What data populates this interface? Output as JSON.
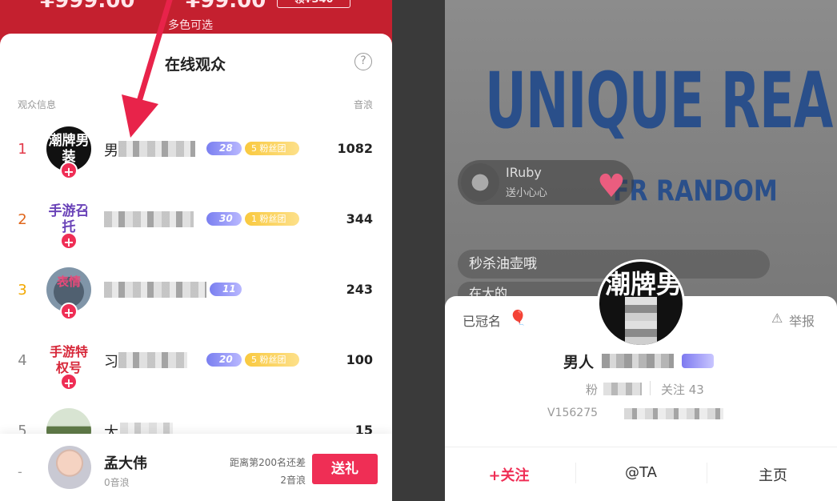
{
  "product": {
    "price_original": "¥999.00",
    "price_sale": "¥99.00",
    "coupon": "领¥340",
    "colors_note": "多色可选"
  },
  "audience": {
    "title": "在线观众",
    "col_left": "观众信息",
    "col_right": "音浪",
    "rows": [
      {
        "rank": "1",
        "avatar_text": "潮牌男装",
        "name": "男",
        "level": "28",
        "fan": "5 粉丝团",
        "score": "1082"
      },
      {
        "rank": "2",
        "avatar_text": "手游召托",
        "name": "",
        "level": "30",
        "fan": "1 粉丝团",
        "score": "344"
      },
      {
        "rank": "3",
        "avatar_text": "表情",
        "name": "",
        "level": "11",
        "fan": "",
        "score": "243"
      },
      {
        "rank": "4",
        "avatar_text": "手游特权号",
        "name": "习",
        "level": "20",
        "fan": "5 粉丝团",
        "score": "100"
      },
      {
        "rank": "5",
        "avatar_text": "",
        "name": "大",
        "level": "",
        "fan": "",
        "score": "15"
      }
    ]
  },
  "me": {
    "rank": "-",
    "name": "孟大伟",
    "sub": "0音浪",
    "gap_line1": "距离第200名还差",
    "gap_line2": "2音浪",
    "gift_label": "送礼"
  },
  "live": {
    "brand_line1": "UNIQUE REALITY",
    "brand_line2": "FR  RANDOM",
    "host_name": "IRuby",
    "host_sub": "送小心心",
    "chat1": "秒杀油壶哦",
    "chat2": "在大的"
  },
  "profile_card": {
    "crowned": "已冠名",
    "report": "举报",
    "avatar_text": "潮牌男",
    "name": "男人",
    "fans_label": "粉",
    "follows_label": "关注 43",
    "id_prefix": "V156275",
    "actions": {
      "follow": "+关注",
      "at": "@TA",
      "home": "主页"
    }
  },
  "icons": {
    "help": "help-icon",
    "report": "warning-icon",
    "crown": "balloon-icon",
    "heart": "heart-icon"
  },
  "colors": {
    "accent": "#ef2e55",
    "header_red": "#c4202f",
    "level_purple": "#7a7ff0",
    "fan_gold": "#f9c93f"
  }
}
